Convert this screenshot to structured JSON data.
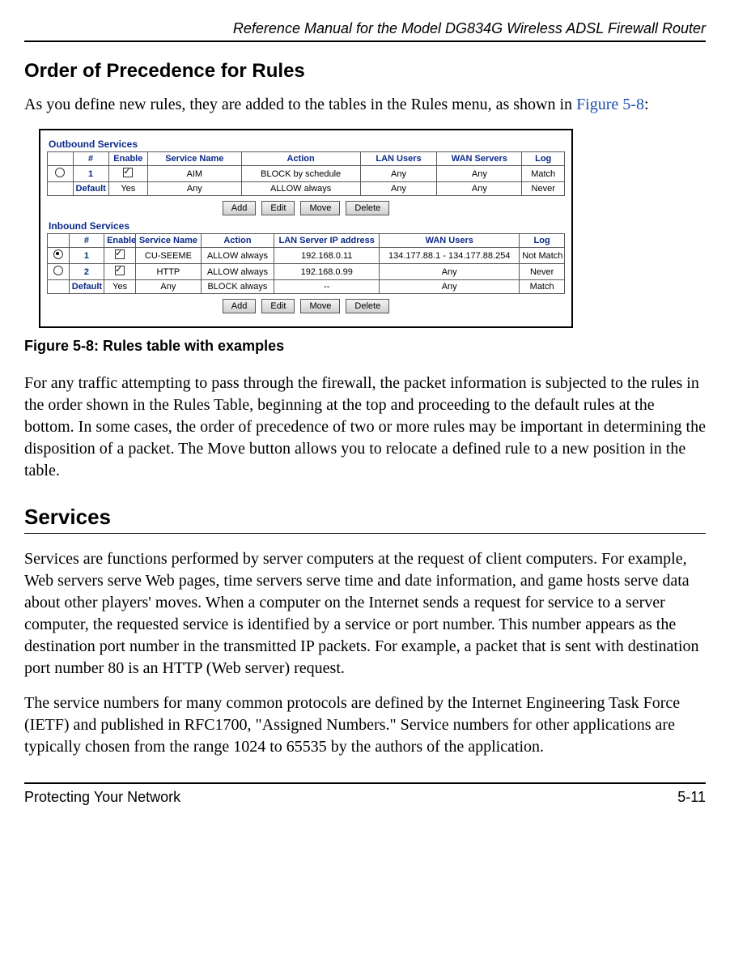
{
  "header": {
    "title": "Reference Manual for the Model DG834G Wireless ADSL Firewall Router"
  },
  "section1": {
    "heading": "Order of Precedence for Rules",
    "intro_pre": "As you define new rules, they are added to the tables in the Rules menu, as shown in ",
    "intro_link": "Figure 5-8",
    "intro_post": ":"
  },
  "screenshot": {
    "outbound": {
      "title": "Outbound Services",
      "headers": [
        "",
        "#",
        "Enable",
        "Service Name",
        "Action",
        "LAN Users",
        "WAN Servers",
        "Log"
      ],
      "rows": [
        {
          "radio": "unsel",
          "num": "1",
          "enable": "check",
          "service": "AIM",
          "action": "BLOCK by schedule",
          "lan": "Any",
          "wan": "Any",
          "log": "Match"
        },
        {
          "radio": "",
          "num": "Default",
          "enable": "Yes",
          "service": "Any",
          "action": "ALLOW always",
          "lan": "Any",
          "wan": "Any",
          "log": "Never"
        }
      ]
    },
    "inbound": {
      "title": "Inbound Services",
      "headers": [
        "",
        "#",
        "Enable",
        "Service Name",
        "Action",
        "LAN Server IP address",
        "WAN Users",
        "Log"
      ],
      "rows": [
        {
          "radio": "sel",
          "num": "1",
          "enable": "check",
          "service": "CU-SEEME",
          "action": "ALLOW always",
          "lan": "192.168.0.11",
          "wan": "134.177.88.1 - 134.177.88.254",
          "log": "Not Match"
        },
        {
          "radio": "unsel",
          "num": "2",
          "enable": "check",
          "service": "HTTP",
          "action": "ALLOW always",
          "lan": "192.168.0.99",
          "wan": "Any",
          "log": "Never"
        },
        {
          "radio": "",
          "num": "Default",
          "enable": "Yes",
          "service": "Any",
          "action": "BLOCK always",
          "lan": "--",
          "wan": "Any",
          "log": "Match"
        }
      ]
    },
    "buttons": {
      "add": "Add",
      "edit": "Edit",
      "move": "Move",
      "delete": "Delete"
    }
  },
  "figure": {
    "caption": "Figure 5-8:  Rules table with examples"
  },
  "para1": "For any traffic attempting to pass through the firewall, the packet information is subjected to the rules in the order shown in the Rules Table, beginning at the top and proceeding to the default rules at the bottom. In some cases, the order of precedence of two or more rules may be important in determining the disposition of a packet. The Move button allows you to relocate a defined rule to a new position in the table.",
  "section2": {
    "heading": "Services"
  },
  "para2": "Services are functions performed by server computers at the request of client computers. For example, Web servers serve Web pages, time servers serve time and date information, and game hosts serve data about other players' moves. When a computer on the Internet sends a request for service to a server computer, the requested service is identified by a service or port number. This number appears as the destination port number in the transmitted IP packets. For example, a packet that is sent with destination port number 80 is an HTTP (Web server) request.",
  "para3": "The service numbers for many common protocols are defined by the Internet Engineering Task Force (IETF) and published in RFC1700, \"Assigned Numbers.\" Service numbers for other applications are typically chosen from the range 1024 to 65535 by the authors of the application.",
  "footer": {
    "left": "Protecting Your Network",
    "right": "5-11"
  }
}
